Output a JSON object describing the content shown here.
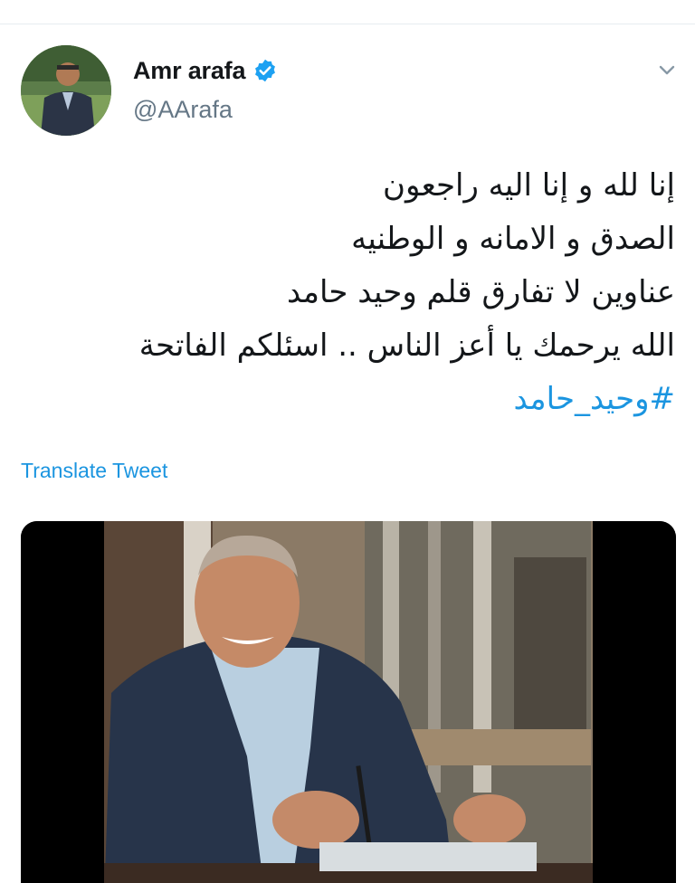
{
  "tweet": {
    "author": {
      "display_name": "Amr arafa",
      "handle": "@AArafa",
      "verified": true,
      "avatar_icon": "profile-photo",
      "verified_icon": "verified-badge-icon"
    },
    "menu_icon": "chevron-down-icon",
    "text_lines": [
      "إنا لله و إنا اليه راجعون",
      "الصدق و الامانه و الوطنيه",
      "عناوين لا تفارق قلم وحيد حامد",
      "الله يرحمك يا أعز الناس .. اسئلكم الفاتحة"
    ],
    "hashtag": "#وحيد_حامد",
    "translate_label": "Translate Tweet",
    "media": {
      "type": "photo",
      "description_icon": "photo-smiling-man-with-pen"
    }
  },
  "colors": {
    "link_blue": "#1b95e0",
    "verified_blue": "#1da1f2",
    "secondary_text": "#657786",
    "primary_text": "#14171a"
  }
}
